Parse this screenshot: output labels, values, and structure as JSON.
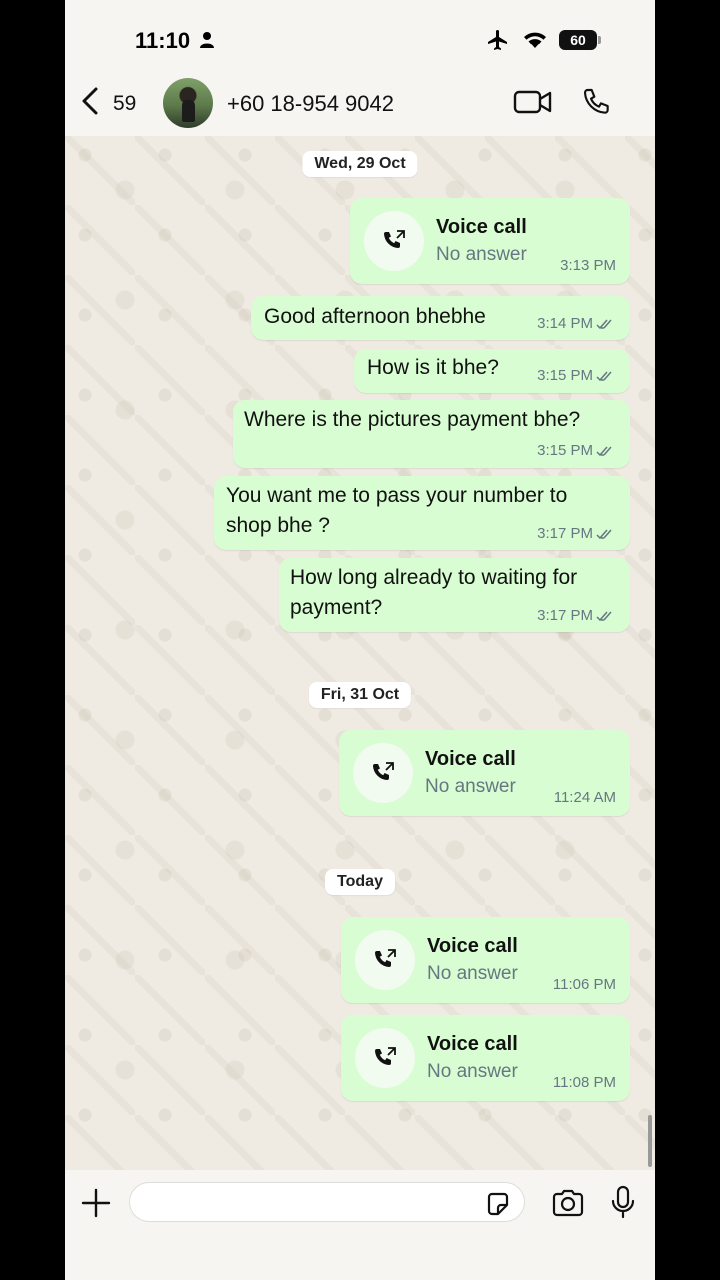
{
  "status_bar": {
    "time": "11:10",
    "battery": "60"
  },
  "header": {
    "back_count": "59",
    "contact_name": "+60 18-954 9042"
  },
  "dates": {
    "d1": "Wed, 29 Oct",
    "d2": "Fri, 31 Oct",
    "d3": "Today"
  },
  "messages": {
    "call1": {
      "title": "Voice call",
      "status": "No answer",
      "time": "3:13 PM"
    },
    "m1": {
      "text": "Good afternoon bhebhe",
      "time": "3:14 PM"
    },
    "m2": {
      "text": "How is it bhe?",
      "time": "3:15 PM"
    },
    "m3": {
      "text": "Where is the pictures payment bhe?",
      "time": "3:15 PM"
    },
    "m4": {
      "line1": "You want  me to pass your number to",
      "line2": "shop bhe ?",
      "time": "3:17 PM"
    },
    "m5": {
      "line1": "How long already to waiting for",
      "line2": "payment?",
      "time": "3:17 PM"
    },
    "call2": {
      "title": "Voice call",
      "status": "No answer",
      "time": "11:24 AM"
    },
    "call3": {
      "title": "Voice call",
      "status": "No answer",
      "time": "11:06 PM"
    },
    "call4": {
      "title": "Voice call",
      "status": "No answer",
      "time": "11:08 PM"
    }
  },
  "input": {
    "placeholder": ""
  },
  "colors": {
    "outgoing_bubble": "#d9fdd3",
    "chat_bg": "#efeae2",
    "read_ticks": "#667781"
  }
}
